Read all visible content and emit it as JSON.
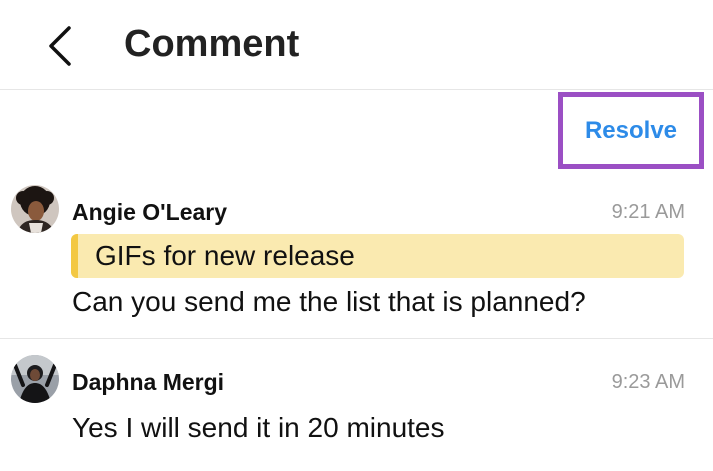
{
  "header": {
    "title": "Comment",
    "back_icon": "chevron-left-icon"
  },
  "actions": {
    "resolve_label": "Resolve"
  },
  "colors": {
    "accent": "#2d8be8",
    "highlight_border": "#9b4fc4",
    "quote_bg": "#faeab0",
    "quote_bar": "#f3c843",
    "timestamp": "#9a9a9a"
  },
  "comments": [
    {
      "author": "Angie O'Leary",
      "time": "9:21 AM",
      "quote": "GIFs for new release",
      "text": "Can you send me the list that is planned?",
      "avatar_icon": "avatar"
    },
    {
      "author": "Daphna Mergi",
      "time": "9:23 AM",
      "text": "Yes I will send it in 20 minutes",
      "avatar_icon": "avatar"
    }
  ]
}
